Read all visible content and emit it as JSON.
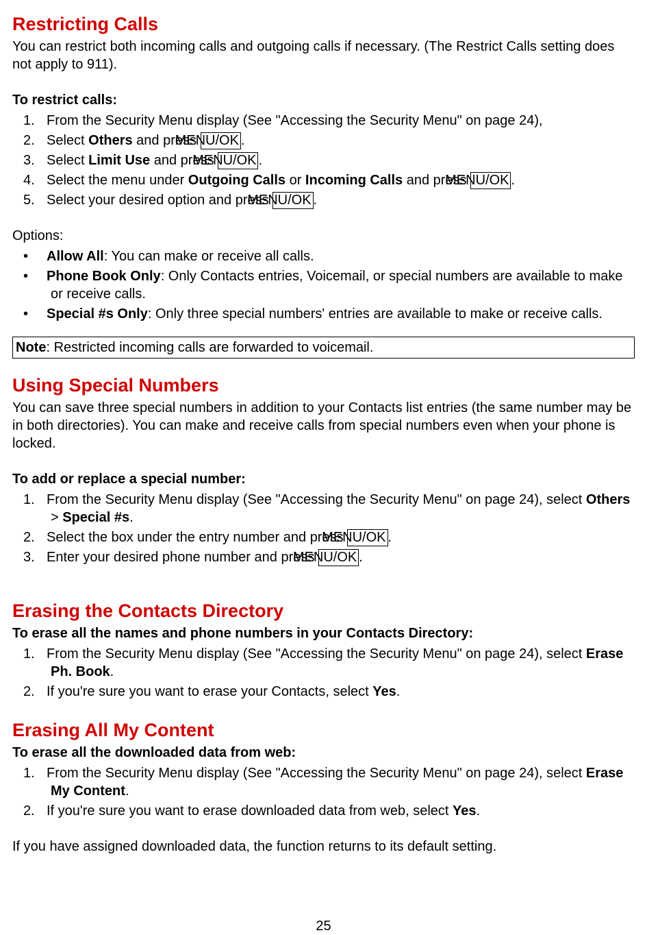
{
  "page_number": "25",
  "section1": {
    "heading": "Restricting Calls",
    "intro": "You can restrict both incoming calls and outgoing calls if necessary. (The Restrict Calls setting does not apply to 911).",
    "subheading": "To restrict calls:",
    "step1_a": "From the Security Menu display (See \"Accessing the Security Menu\" on page 24),",
    "step2_a": "Select ",
    "step2_b": "Others",
    "step2_c": " and press ",
    "step2_key": "MENU/OK",
    "step2_d": ".",
    "step3_a": "Select ",
    "step3_b": "Limit Use",
    "step3_c": " and press ",
    "step3_key": "MENU/OK",
    "step3_d": ".",
    "step4_a": "Select the menu under ",
    "step4_b": "Outgoing Calls",
    "step4_c": " or ",
    "step4_d": "Incoming Calls",
    "step4_e": " and press ",
    "step4_key": "MENU/OK",
    "step4_f": ".",
    "step5_a": "Select your desired option and press ",
    "step5_key": "MENU/OK",
    "step5_b": ".",
    "options_label": "Options:",
    "opt1_b": "Allow All",
    "opt1_t": ": You can make or receive all calls.",
    "opt2_b": "Phone Book Only",
    "opt2_t": ": Only Contacts entries, Voicemail, or special numbers are available to make or receive calls.",
    "opt3_b": "Special #s Only",
    "opt3_t": ": Only three special numbers' entries are available to make or receive calls.",
    "note_b": "Note",
    "note_t": ": Restricted incoming calls are forwarded to voicemail."
  },
  "section2": {
    "heading": "Using Special Numbers",
    "intro": "You can save three special numbers in addition to your Contacts list entries (the same number may be in both directories). You can make and receive calls from special numbers even when your phone is locked.",
    "subheading": "To add or replace a special number:",
    "step1_a": "From the Security Menu display (See \"Accessing the Security Menu\" on page 24), select ",
    "step1_b": "Others",
    "step1_c": " > ",
    "step1_d": "Special #s",
    "step1_e": ".",
    "step2_a": "Select the box under the entry number and press ",
    "step2_key": "MENU/OK",
    "step2_b": ".",
    "step3_a": "Enter your desired phone number and press ",
    "step3_key": "MENU/OK",
    "step3_b": "."
  },
  "section3": {
    "heading": "Erasing the Contacts Directory",
    "subheading": "To erase all the names and phone numbers in your Contacts Directory:",
    "step1_a": "From the Security Menu display (See \"Accessing the Security Menu\" on page 24), select ",
    "step1_b": "Erase Ph. Book",
    "step1_c": ".",
    "step2_a": "If you're sure you want to erase your Contacts, select ",
    "step2_b": "Yes",
    "step2_c": "."
  },
  "section4": {
    "heading": "Erasing All My Content",
    "subheading": "To erase all the downloaded data from web:",
    "step1_a": "From the Security Menu display (See \"Accessing the Security Menu\" on page 24), select ",
    "step1_b": "Erase My Content",
    "step1_c": ".",
    "step2_a": "If you're sure you want to erase downloaded data from web, select ",
    "step2_b": "Yes",
    "step2_c": ".",
    "trailing": "If you have assigned downloaded data, the function returns to its default setting."
  }
}
